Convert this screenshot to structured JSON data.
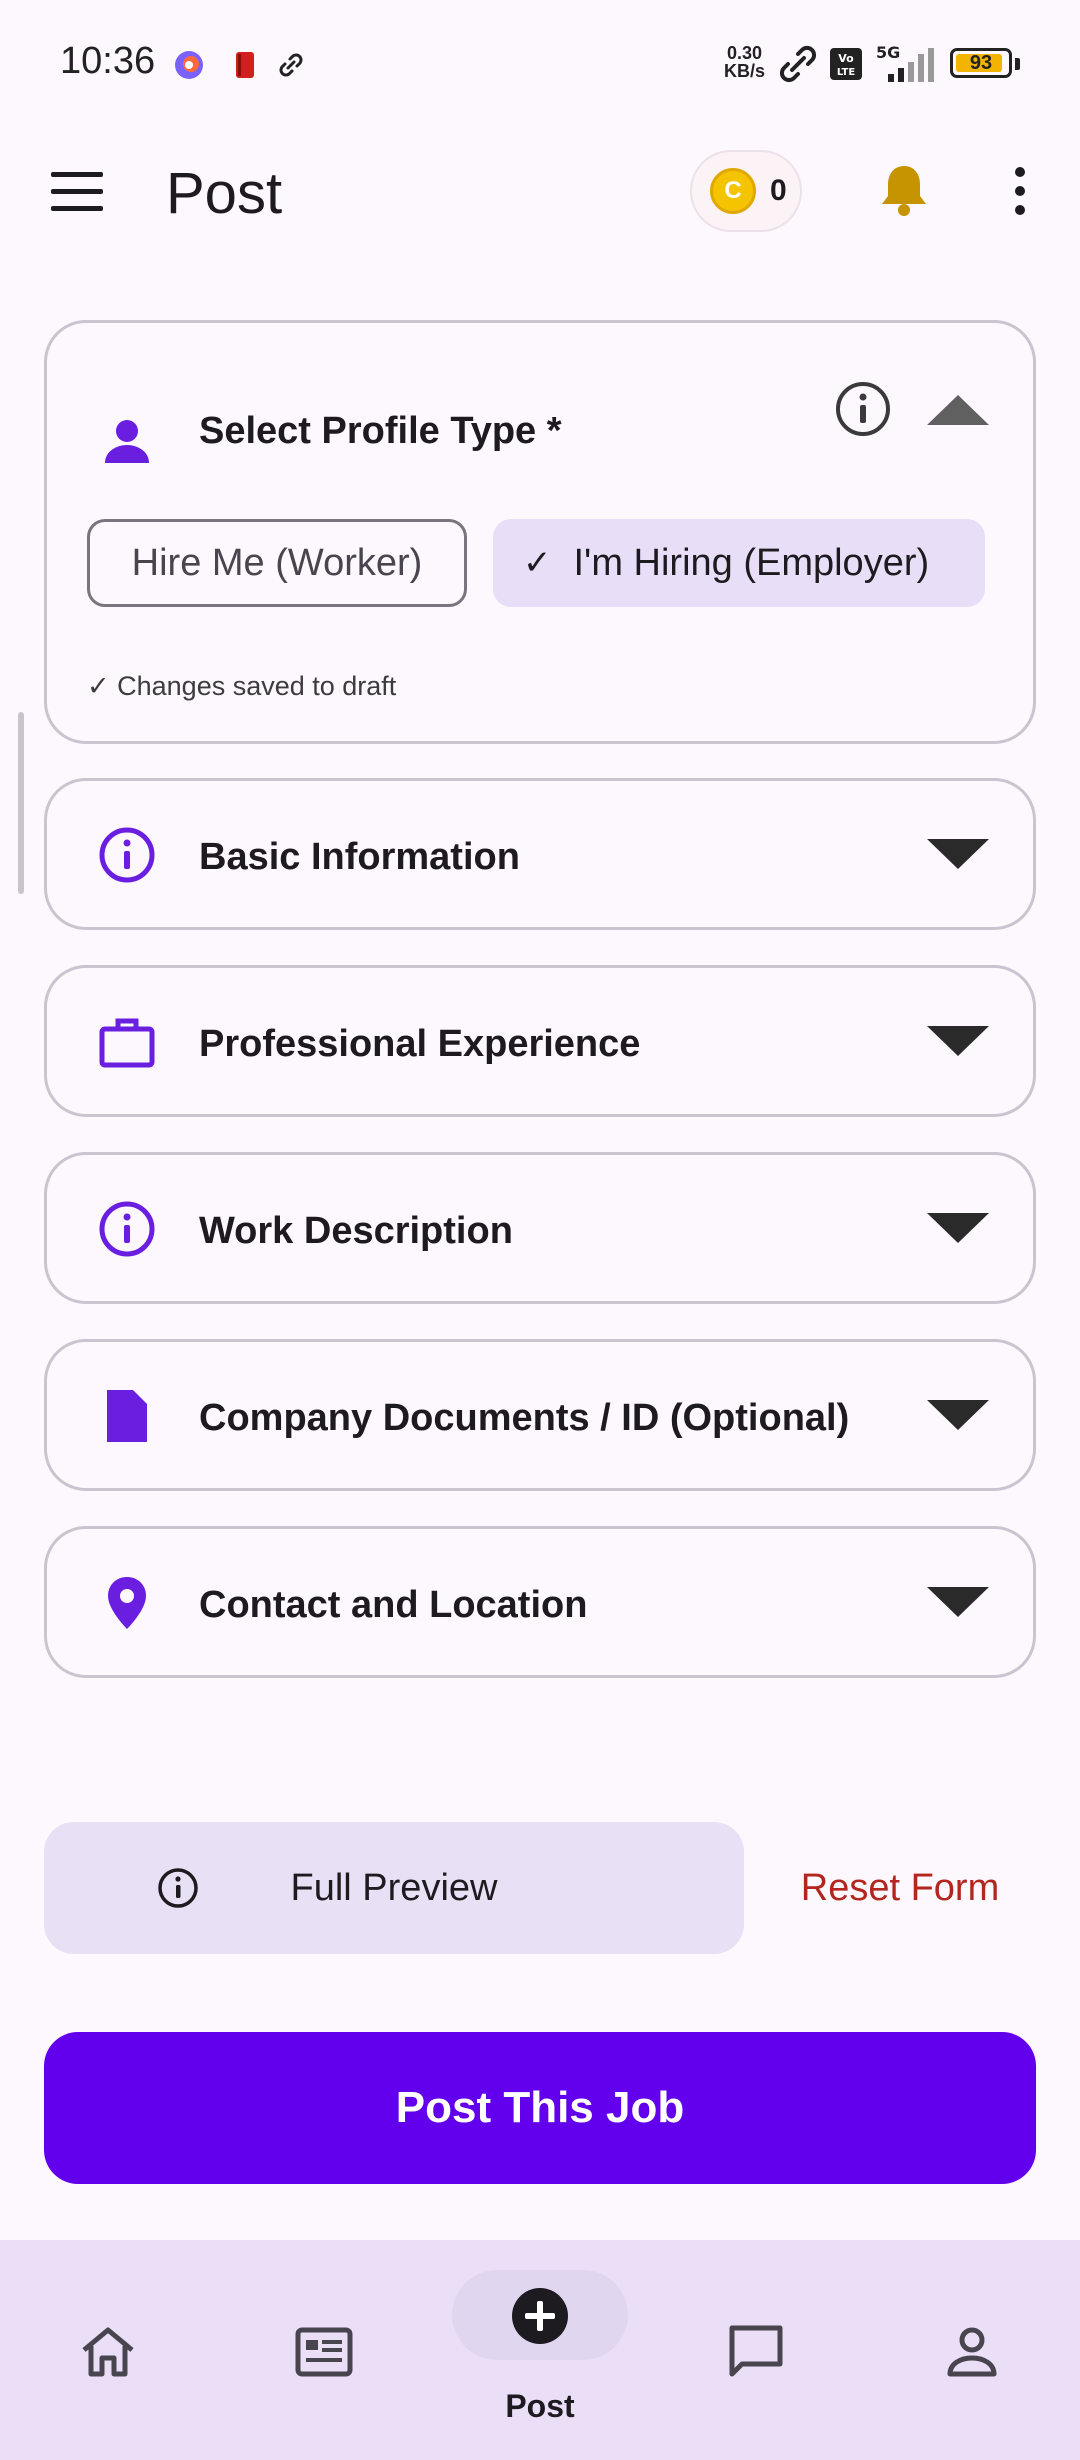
{
  "status_bar": {
    "time": "10:36",
    "net_speed_value": "0.30",
    "net_speed_unit": "KB/s",
    "network": "5G",
    "volte": "Vo LTE",
    "battery": "93",
    "battery_level": 0.93
  },
  "app_bar": {
    "title": "Post",
    "coin_symbol": "C",
    "coin_count": "0"
  },
  "profile_card": {
    "title": "Select Profile Type *",
    "chips": [
      {
        "label": "Hire Me (Worker)",
        "selected": false
      },
      {
        "label": "I'm Hiring (Employer)",
        "selected": true
      }
    ],
    "check_mark": "✓",
    "draft_note": "✓ Changes saved to draft"
  },
  "sections": [
    {
      "title": "Basic Information",
      "icon": "info-icon"
    },
    {
      "title": "Professional Experience",
      "icon": "briefcase-icon"
    },
    {
      "title": "Work Description",
      "icon": "info-icon"
    },
    {
      "title": "Company Documents / ID (Optional)",
      "icon": "document-icon"
    },
    {
      "title": "Contact and Location",
      "icon": "location-pin-icon"
    }
  ],
  "actions": {
    "preview_label": "Full Preview",
    "reset_label": "Reset Form",
    "post_label": "Post This Job"
  },
  "bottom_nav": {
    "items": [
      {
        "name": "home",
        "label": ""
      },
      {
        "name": "feed",
        "label": ""
      },
      {
        "name": "post",
        "label": "Post",
        "active": true
      },
      {
        "name": "messages",
        "label": ""
      },
      {
        "name": "profile",
        "label": ""
      }
    ]
  },
  "colors": {
    "primary": "#6200ee",
    "icon_purple": "#6a1fe0",
    "bell": "#c69400",
    "reset": "#b3261e",
    "selected_chip": "#e8def8"
  }
}
